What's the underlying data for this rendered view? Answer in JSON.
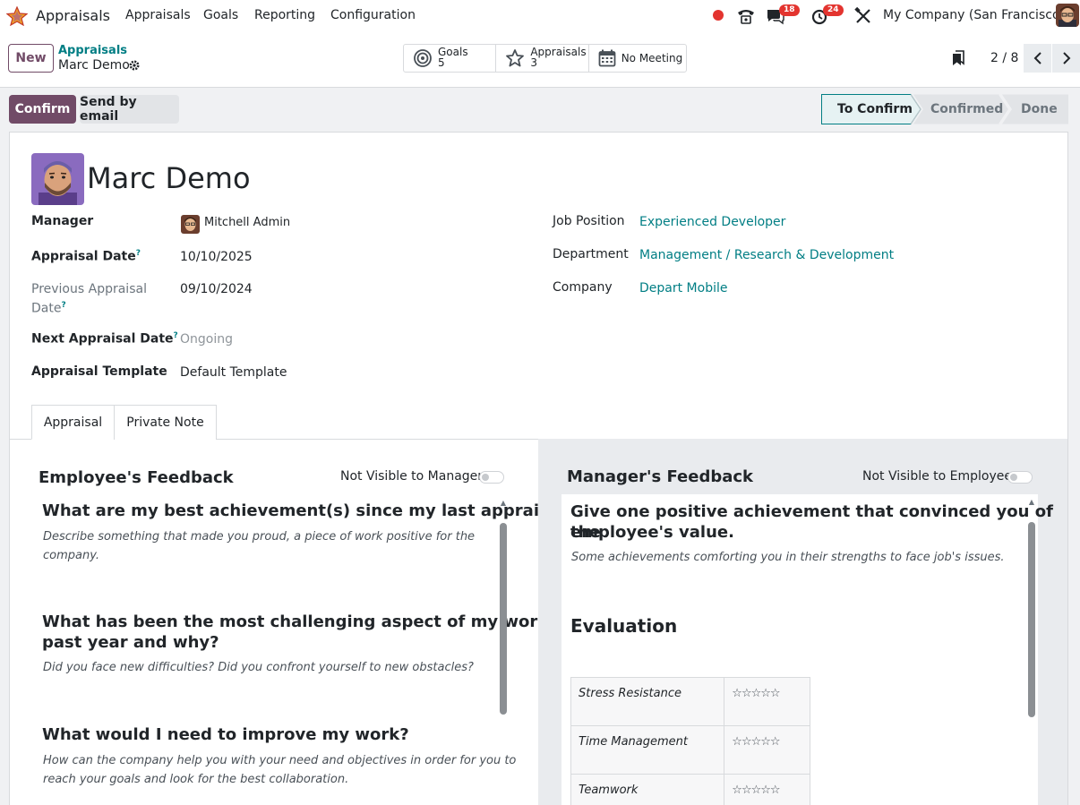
{
  "nav": {
    "app_title": "Appraisals",
    "menu": [
      "Appraisals",
      "Goals",
      "Reporting",
      "Configuration"
    ],
    "chat_badge": "18",
    "activity_badge": "24",
    "company": "My Company (San Francisco)"
  },
  "control": {
    "new_label": "New",
    "breadcrumb_parent": "Appraisals",
    "breadcrumb_current": "Marc Demo",
    "smart_buttons": {
      "goals_label": "Goals",
      "goals_value": "5",
      "appraisals_label": "Appraisals",
      "appraisals_value": "3",
      "meeting_label": "No Meeting"
    },
    "pager": "2 / 8"
  },
  "statusbar": {
    "confirm_label": "Confirm",
    "email_label": "Send by email",
    "stages": [
      "To Confirm",
      "Confirmed",
      "Done"
    ],
    "active_stage": "To Confirm"
  },
  "form": {
    "employee_name": "Marc Demo",
    "left": {
      "manager_label": "Manager",
      "manager_value": "Mitchell Admin",
      "appraisal_date_label": "Appraisal Date",
      "appraisal_date_value": "10/10/2025",
      "prev_date_label_1": "Previous Appraisal",
      "prev_date_label_2": "Date",
      "prev_date_value": "09/10/2024",
      "next_date_label": "Next Appraisal Date",
      "next_date_value": "Ongoing",
      "template_label": "Appraisal Template",
      "template_value": "Default Template"
    },
    "right": {
      "job_label": "Job Position",
      "job_value": "Experienced Developer",
      "dept_label": "Department",
      "dept_value": "Management / Research & Development",
      "company_label": "Company",
      "company_value": "Depart Mobile"
    },
    "help_mark": "?"
  },
  "tabs": [
    "Appraisal",
    "Private Note"
  ],
  "employee_feedback": {
    "title": "Employee's Feedback",
    "visibility_label": "Not Visible to Manager",
    "questions": [
      {
        "q": "What are my best achievement(s) since my last appraisal?",
        "d1": "Describe something that made you proud, a piece of work positive for the",
        "d2": "company."
      },
      {
        "q1": "What has been the most challenging aspect of my work this",
        "q2": "past year and why?",
        "d": "Did you face new difficulties? Did you confront yourself to new obstacles?"
      },
      {
        "q": "What would I need to improve my work?",
        "d1": "How can the company help you with your need and objectives in order for you to",
        "d2": "reach your goals and look for the best collaboration."
      }
    ]
  },
  "manager_feedback": {
    "title": "Manager's Feedback",
    "visibility_label": "Not Visible to Employee",
    "q1": "Give one positive achievement that convinced you of the",
    "q2": "employee's value.",
    "d": "Some achievements comforting you in their strengths to face job's issues.",
    "evaluation_title": "Evaluation",
    "evaluation_rows": [
      {
        "name": "Stress Resistance",
        "stars": "☆☆☆☆☆"
      },
      {
        "name": "Time Management",
        "stars": "☆☆☆☆☆"
      },
      {
        "name": "Teamwork",
        "stars": "☆☆☆☆☆"
      }
    ]
  },
  "colors": {
    "brand": "#714b67",
    "link": "#017e84",
    "badge": "#e3342f"
  }
}
